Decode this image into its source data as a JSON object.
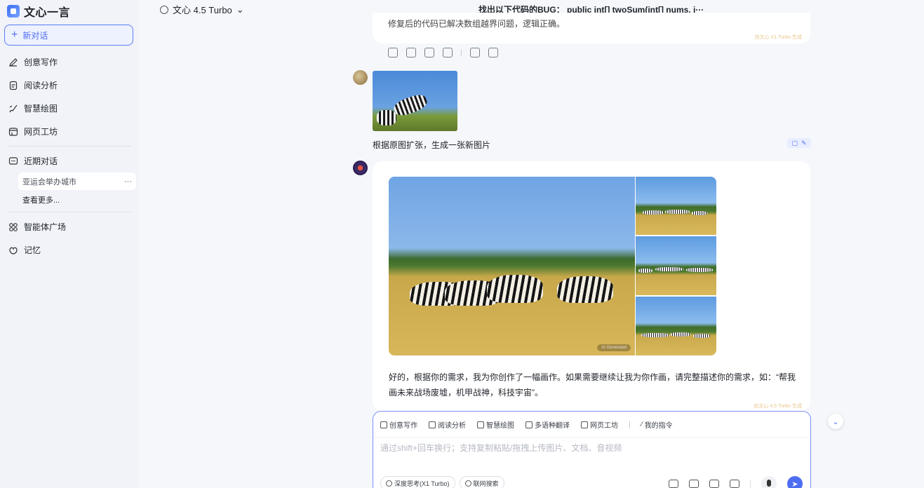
{
  "app": {
    "logo_text": "文心一言"
  },
  "sidebar": {
    "new_chat": "新对话",
    "items": [
      {
        "label": "创意写作",
        "icon": "pen-icon"
      },
      {
        "label": "阅读分析",
        "icon": "document-icon"
      },
      {
        "label": "智慧绘图",
        "icon": "brush-icon"
      },
      {
        "label": "网页工坊",
        "icon": "webpage-icon"
      }
    ],
    "recent_title": "近期对话",
    "recent_items": [
      {
        "label": "亚运会举办城市",
        "more": "···"
      }
    ],
    "see_more": "查看更多...",
    "bottom_items": [
      {
        "label": "智能体广场",
        "icon": "grid-icon"
      },
      {
        "label": "记忆",
        "icon": "memory-icon"
      }
    ]
  },
  "header": {
    "model": "文心 4.5 Turbo",
    "chat_title": "找出以下代码的BUG： public int[] twoSum(int[] nums, i···"
  },
  "messages": {
    "prev_card": {
      "cut_text": "修复后的代码已解决数组越界问题，逻辑正确。",
      "gen_tag": "由文心 X1 Turbo 生成"
    },
    "user": {
      "text": "根据原图扩张，生成一张新图片"
    },
    "bot": {
      "text": "好的，根据你的需求，我为你创作了一幅画作。如果需要继续让我为你作画，请完整描述你的需求，如：“帮我画未来战场废墟，机甲战神，科技宇宙”。",
      "ai_tag": "AI Generated",
      "gen_tag": "由文心 4.5 Turbo 生成"
    }
  },
  "composer": {
    "tools": [
      {
        "label": "创意写作"
      },
      {
        "label": "阅读分析"
      },
      {
        "label": "智慧绘图"
      },
      {
        "label": "多语种翻译"
      },
      {
        "label": "网页工坊"
      }
    ],
    "my_prompts": "我的指令",
    "placeholder": "通过shift+回车换行；支持复制粘贴/拖拽上传图片、文档、音视频",
    "chips": [
      {
        "label": "深度思考(X1 Turbo)"
      },
      {
        "label": "联网搜索"
      }
    ]
  },
  "colors": {
    "accent": "#4e6ef2",
    "sidebar_bg": "#f1f3f9",
    "page_bg": "#f5f7fb"
  }
}
